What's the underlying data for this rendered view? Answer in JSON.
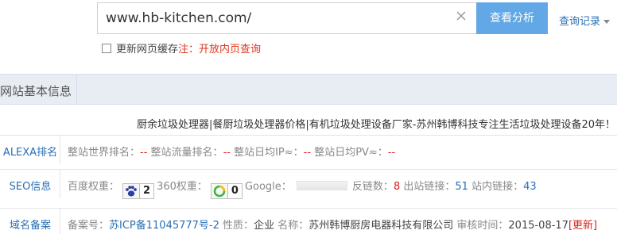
{
  "search": {
    "value": "www.hb-kitchen.com/",
    "button_label": "查看分析",
    "history_label": "查询记录"
  },
  "refresh": {
    "label": "更新网页缓存",
    "note": "注：开放内页查询"
  },
  "section": {
    "title": "网站基本信息"
  },
  "site_title": "厨余垃圾处理器|餐厨垃圾处理器价格|有机垃圾处理设备厂家-苏州韩博科技专注生活垃圾处理设备20年！",
  "alexa": {
    "label": "ALEXA排名",
    "world_rank_label": "整站世界排名：",
    "world_rank_value": "--",
    "traffic_rank_label": "整站流量排名：",
    "traffic_rank_value": "--",
    "daily_ip_label": "整站日均IP≈：",
    "daily_ip_value": "--",
    "daily_pv_label": "整站日均PV≈：",
    "daily_pv_value": "--"
  },
  "seo": {
    "label": "SEO信息",
    "baidu_weight_label": "百度权重：",
    "baidu_weight_value": "2",
    "baidu_icon": "baidu-paw-icon",
    "so_weight_label": "360权重：",
    "so_weight_value": "0",
    "so_icon": "360-ring-icon",
    "google_label": "Google：",
    "backlinks_label": "反链数：",
    "backlinks_value": "8",
    "outbound_label": "出站链接：",
    "outbound_value": "51",
    "inbound_label": "站内链接：",
    "inbound_value": "43"
  },
  "icp": {
    "label": "域名备案",
    "number_label": "备案号：",
    "number_value": "苏ICP备11045777号-2",
    "nature_label": "性质：",
    "nature_value": "企业",
    "name_label": "名称：",
    "name_value": "苏州韩博厨房电器科技有限公司",
    "audit_label": "审核时间：",
    "audit_value": "2015-08-17",
    "update_label": "[更新]"
  },
  "colors": {
    "accent": "#62a8e6",
    "link": "#2a6fb5",
    "red": "#d9201a",
    "header_bg": "#e8ecf3"
  }
}
